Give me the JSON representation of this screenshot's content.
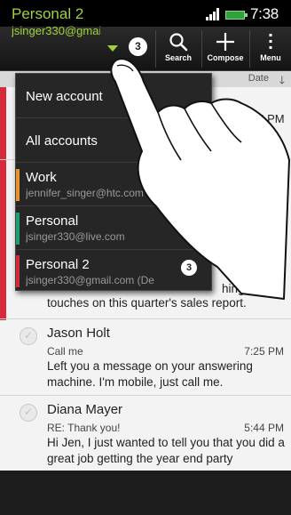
{
  "status_bar": {
    "time": "7:38",
    "ampm": "PM"
  },
  "action_bar": {
    "account_name": "Personal 2",
    "account_email": "jsinger330@gmail.com",
    "unread_badge": "3",
    "actions": [
      {
        "label": "Search",
        "icon": "search-icon"
      },
      {
        "label": "Compose",
        "icon": "plus-icon"
      },
      {
        "label": "Menu",
        "icon": "more-vert-icon"
      }
    ]
  },
  "sort": {
    "label": "Date"
  },
  "account_menu": {
    "items": [
      {
        "title": "New account"
      },
      {
        "title": "All accounts"
      },
      {
        "title": "Work",
        "email": "jennifer_singer@htc.com",
        "color": "#e8922a"
      },
      {
        "title": "Personal",
        "email": "jsinger330@live.com",
        "color": "#1f9e74"
      },
      {
        "title": "Personal 2",
        "email": "jsinger330@gmail.com (De",
        "color": "#d62b3b",
        "badge": "3"
      }
    ]
  },
  "messages": {
    "partial_time_1": "35 PM",
    "partial_text_1": "up",
    "partial_time_2": "M",
    "partial_text_2": "hing",
    "partial_preview": "touches on this quarter's sales report.",
    "items": [
      {
        "sender": "Jason Holt",
        "subject": "Call me",
        "time": "7:25 PM",
        "preview": "Left you a message on your answering machine. I'm mobile, just call me."
      },
      {
        "sender": "Diana Mayer",
        "subject": "RE: Thank you!",
        "time": "5:44 PM",
        "preview": "Hi Jen, I just wanted to tell you that you did a great job getting the year end party"
      }
    ]
  },
  "colors": {
    "accent": "#9fd337",
    "account_red": "#d62b3b"
  }
}
